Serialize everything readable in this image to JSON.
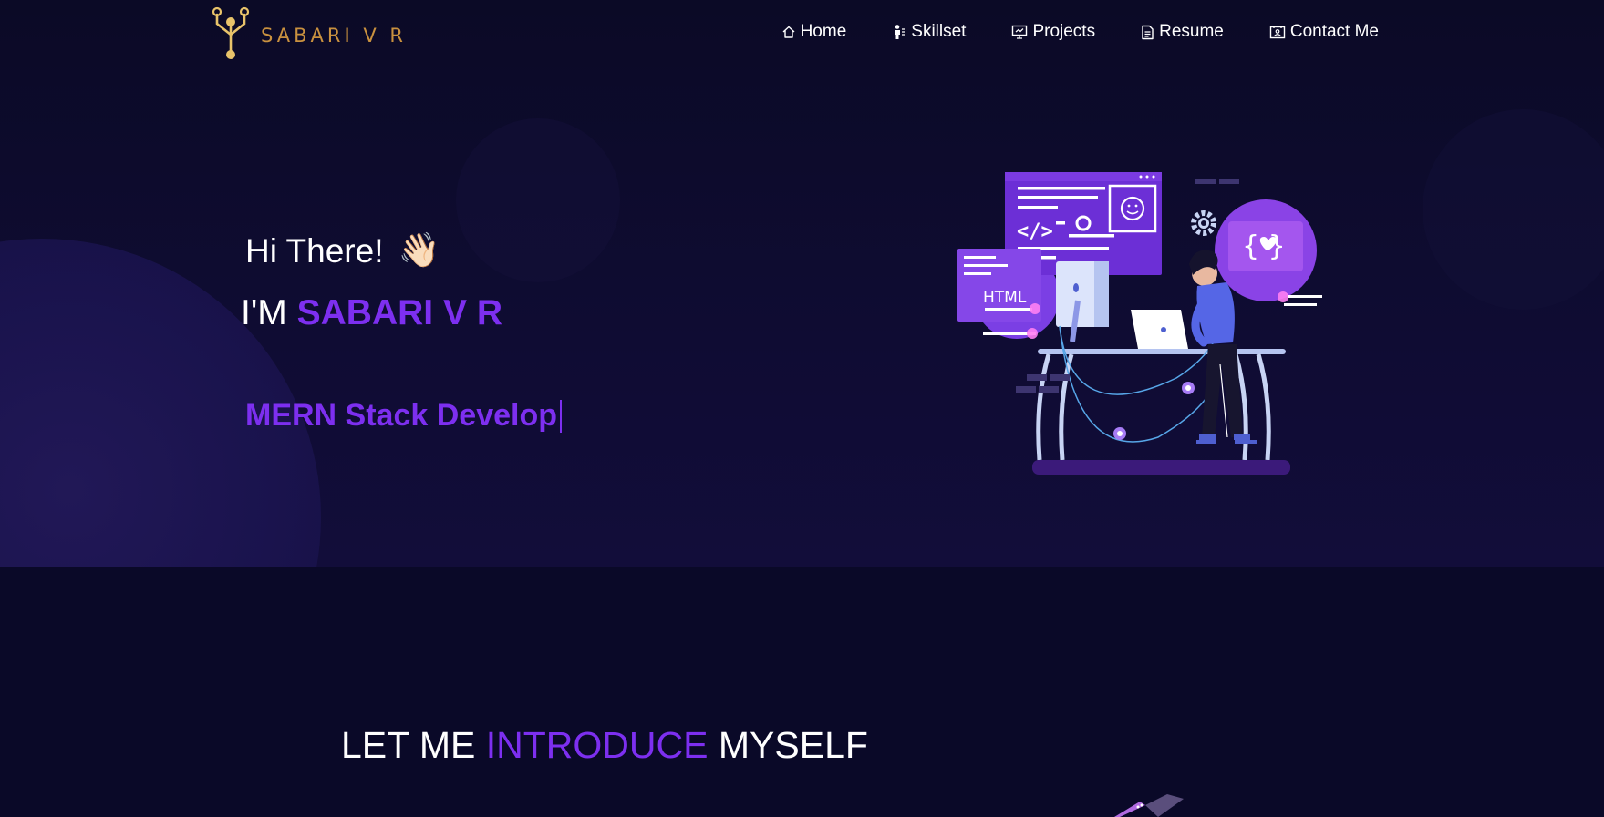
{
  "colors": {
    "accent": "#7d2ff0",
    "logo_gold": "#c9913f",
    "background": "#0c0b24"
  },
  "brand": {
    "logo_text": "SABARI V R",
    "icon": "circuit-tree-logo"
  },
  "nav": {
    "items": [
      {
        "label": "Home",
        "icon": "home-icon"
      },
      {
        "label": "Skillset",
        "icon": "person-icon"
      },
      {
        "label": "Projects",
        "icon": "presentation-icon"
      },
      {
        "label": "Resume",
        "icon": "document-icon"
      },
      {
        "label": "Contact Me",
        "icon": "contact-card-icon"
      }
    ]
  },
  "hero": {
    "greeting": "Hi There!",
    "wave_emoji": "👋🏻",
    "intro_prefix": "I'M",
    "name": "SABARI V R",
    "typed_role": "MERN Stack Develop"
  },
  "illustration": {
    "html_tag": "HTML",
    "code_symbol": "</>",
    "braces_symbol": "{ }"
  },
  "about": {
    "title_prefix": "LET ME",
    "title_highlight": "INTRODUCE",
    "title_suffix": "MYSELF"
  }
}
